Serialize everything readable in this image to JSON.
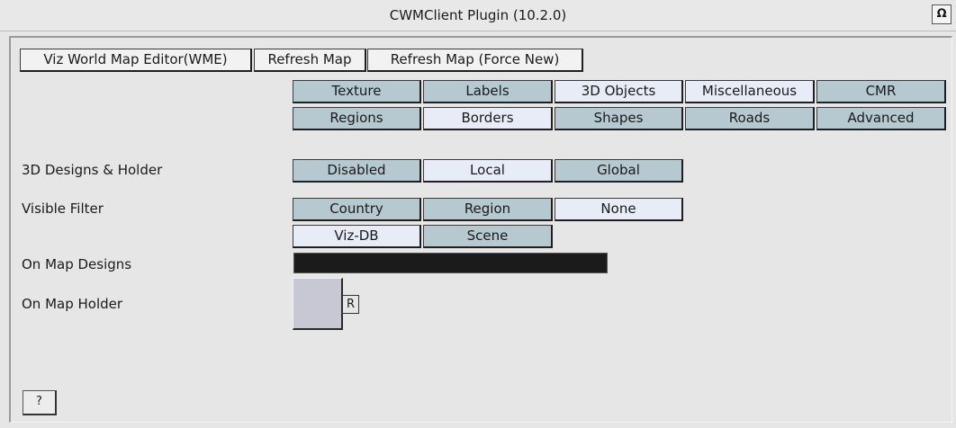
{
  "window": {
    "title": "CWMClient Plugin (10.2.0)",
    "help_glyph": "Ω"
  },
  "toolbar": {
    "wme": "Viz World Map Editor(WME)",
    "refresh": "Refresh Map",
    "refresh_force": "Refresh Map (Force New)"
  },
  "tabs_row1": [
    "Texture",
    "Labels",
    "3D Objects",
    "Miscellaneous",
    "CMR"
  ],
  "tabs_row2": [
    "Regions",
    "Borders",
    "Shapes",
    "Roads",
    "Advanced"
  ],
  "designs_holder": {
    "label": "3D Designs & Holder",
    "options": [
      "Disabled",
      "Local",
      "Global"
    ]
  },
  "visible_filter": {
    "label": "Visible Filter",
    "options": [
      "Country",
      "Region",
      "None",
      "Viz-DB",
      "Scene"
    ]
  },
  "on_map_designs": {
    "label": "On Map Designs"
  },
  "on_map_holder": {
    "label": "On Map Holder",
    "r_button": "R"
  },
  "help_button": "?",
  "colors": {
    "tab_blue": "#b6c8d0",
    "tab_active": "#e7ecf6",
    "dark_field": "#1b1b1b"
  }
}
